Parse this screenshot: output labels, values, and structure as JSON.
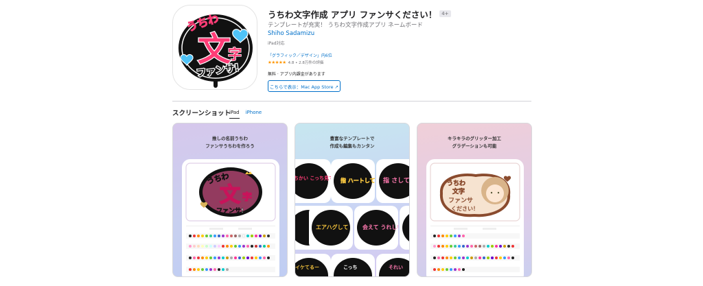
{
  "app": {
    "title": "うちわ文字作成 アプリ ファンサください！",
    "age_badge": "4+",
    "subtitle": "テンプレートが充実！ うちわ文字作成アプリ ネームボード",
    "developer": "Shiho Sadamizu",
    "device": "iPad対応",
    "rank": "「グラフィック／デザイン」内6位",
    "rating_stars": "★★★★★",
    "rating_text": "4.8 • 2.8万件の評価",
    "price": "無料 · アプリ内課金があります",
    "mac_button": "こちらで表示：Mac App Store ↗"
  },
  "icon_art": {
    "text_uchiwa": "うちわ",
    "text_moji": "文",
    "text_ji": "字",
    "text_fansa": "ファンサ!"
  },
  "screenshots": {
    "heading": "スクリーンショット",
    "tabs": [
      {
        "label": "iPad"
      },
      {
        "label": "iPhone"
      }
    ],
    "items": [
      {
        "caption_line1": "推しの名前うちわ",
        "caption_line2": "ファンサうちわを作ろう",
        "art_uchiwa": "うちわ",
        "art_moji": "文",
        "art_ji": "字",
        "art_fansa": "ファンサ!"
      },
      {
        "caption_line1": "豊富なテンプレートで",
        "caption_line2": "作成も編集もカンタン",
        "tiles": [
          "ちかい こっち見て!",
          "指 ハートして",
          "指 さして",
          "エアハグして",
          "会えて うれしい",
          "イケてるー",
          "こっち",
          "それい"
        ]
      },
      {
        "caption_line1": "キラキラのグリッター加工",
        "caption_line2": "グラデーションも可能",
        "art_line1": "うちわ",
        "art_line2": "文字",
        "art_line3": "ファンサ",
        "art_line4": "ください！"
      }
    ]
  },
  "colors": {
    "link": "#0070c9",
    "uchiwa_black": "#111111",
    "pink": "#ff3d77",
    "heart_blue": "#4fc3f7",
    "star": "#ff9500"
  }
}
